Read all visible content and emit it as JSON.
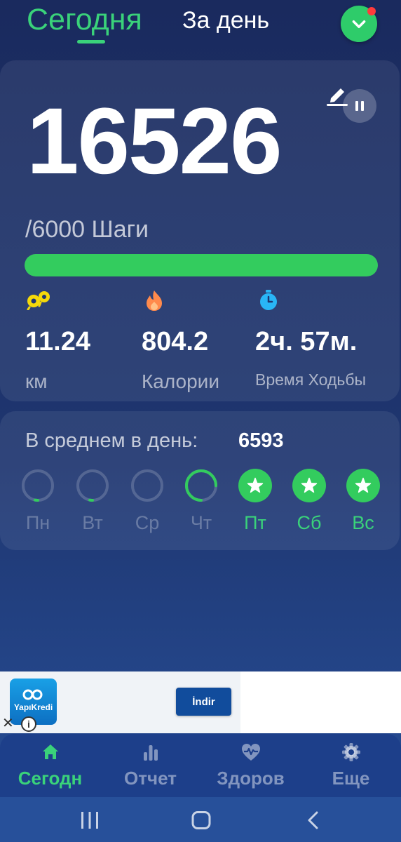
{
  "header": {
    "tab_today": "Сегодня",
    "tab_day": "За день",
    "dropdown_icon": "chevron-down-icon",
    "notification": true
  },
  "steps": {
    "value": "16526",
    "goal_text": "/6000 Шаги",
    "progress": 1.0
  },
  "stats": [
    {
      "icon": "footprints-icon",
      "value": "11.24",
      "label": "км",
      "icon_color": "#f5d90a"
    },
    {
      "icon": "flame-icon",
      "value": "804.2",
      "label": "Калории",
      "icon_color": "#ff8a4c"
    },
    {
      "icon": "stopwatch-icon",
      "value": "2ч. 57м.",
      "label": "Время Ходьбы",
      "icon_color": "#29b6f6"
    }
  ],
  "average": {
    "label": "В среднем в день:",
    "value": "6593"
  },
  "week": [
    {
      "label": "Пн",
      "progress": 0.03,
      "done": false
    },
    {
      "label": "Вт",
      "progress": 0.03,
      "done": false
    },
    {
      "label": "Ср",
      "progress": 0,
      "done": false
    },
    {
      "label": "Чт",
      "progress": 0.75,
      "done": false
    },
    {
      "label": "Пт",
      "progress": 1,
      "done": true
    },
    {
      "label": "Сб",
      "progress": 1,
      "done": true
    },
    {
      "label": "Вс",
      "progress": 1,
      "done": true
    }
  ],
  "ad": {
    "logo_text": "YapıKredi",
    "button_label": "İndir",
    "close_symbol": "✕",
    "info_symbol": "i"
  },
  "bottom_nav": [
    {
      "icon": "home-icon",
      "label": "Сегодн",
      "active": true
    },
    {
      "icon": "bar-chart-icon",
      "label": "Отчет",
      "active": false
    },
    {
      "icon": "heart-pulse-icon",
      "label": "Здоров",
      "active": false
    },
    {
      "icon": "gear-icon",
      "label": "Еще",
      "active": false
    }
  ],
  "colors": {
    "accent_green": "#3ad27a",
    "background_top": "#1a2a5e",
    "background_bottom": "#27509a"
  }
}
